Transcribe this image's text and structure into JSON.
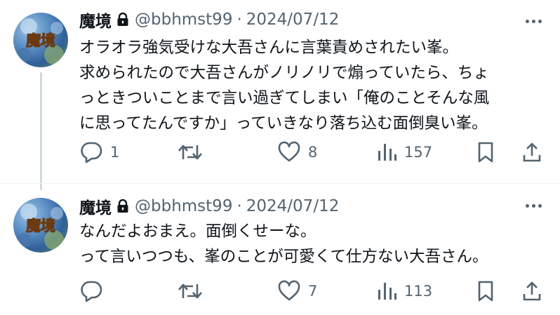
{
  "tweets": [
    {
      "display_name": "魔境",
      "handle": "@bbhmst99",
      "separator": "·",
      "date": "2024/07/12",
      "avatar_text": "魔境",
      "lines": [
        "オラオラ強気受けな大吾さんに言葉責めされたい峯。",
        "求められたので大吾さんがノリノリで煽っていたら、ちょ",
        "っときついことまで言い過ぎてしまい「俺のことそんな風",
        "に思ってたんですか」っていきなり落ち込む面倒臭い峯。"
      ],
      "replies": "1",
      "retweets": "",
      "likes": "8",
      "views": "157"
    },
    {
      "display_name": "魔境",
      "handle": "@bbhmst99",
      "separator": "·",
      "date": "2024/07/12",
      "avatar_text": "魔境",
      "lines": [
        "なんだよおまえ。面倒くせーな。",
        "って言いつつも、峯のことが可愛くて仕方ない大吾さん。"
      ],
      "replies": "",
      "retweets": "",
      "likes": "7",
      "views": "113"
    }
  ],
  "icons": [
    "lock-icon",
    "more-icon",
    "reply-icon",
    "retweet-icon",
    "like-icon",
    "views-icon",
    "bookmark-icon",
    "share-icon"
  ],
  "colors": {
    "text": "#0f1419",
    "secondary": "#536471",
    "divider": "#eff3f4",
    "thread_line": "#cfd9de"
  }
}
